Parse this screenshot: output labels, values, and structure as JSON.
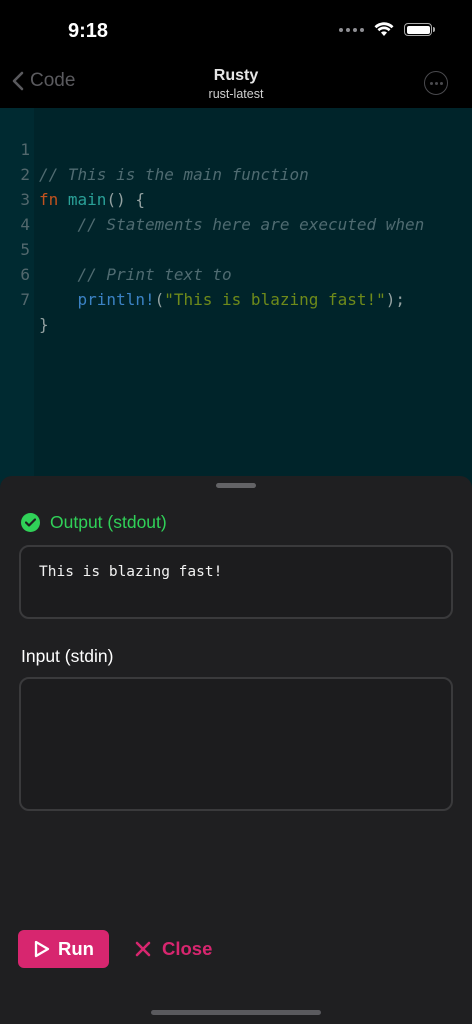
{
  "status_bar": {
    "time": "9:18",
    "icons": [
      "signal-dots-icon",
      "wifi-icon",
      "battery-icon"
    ]
  },
  "nav": {
    "back_label": "Code",
    "title": "Rusty",
    "subtitle": "rust-latest",
    "more_icon": "ellipsis-circle-icon"
  },
  "editor": {
    "lines": [
      {
        "number": "1",
        "text": "// This is the main function"
      },
      {
        "number": "2",
        "text": "fn main() {"
      },
      {
        "number": "3",
        "text": "    // Statements here are executed when"
      },
      {
        "number": "4",
        "text": ""
      },
      {
        "number": "5",
        "text": "    // Print text to"
      },
      {
        "number": "6",
        "text": "    println!(\"This is blazing fast!\");"
      },
      {
        "number": "7",
        "text": "}"
      }
    ]
  },
  "output": {
    "label": "Output (stdout)",
    "status": "success",
    "text": "This is blazing fast!"
  },
  "input": {
    "label": "Input (stdin)",
    "value": ""
  },
  "actions": {
    "run_label": "Run",
    "close_label": "Close"
  },
  "colors": {
    "accent": "#d7266f",
    "success": "#30d158",
    "editor_bg": "#00242a",
    "sheet_bg": "#1f1f21"
  }
}
